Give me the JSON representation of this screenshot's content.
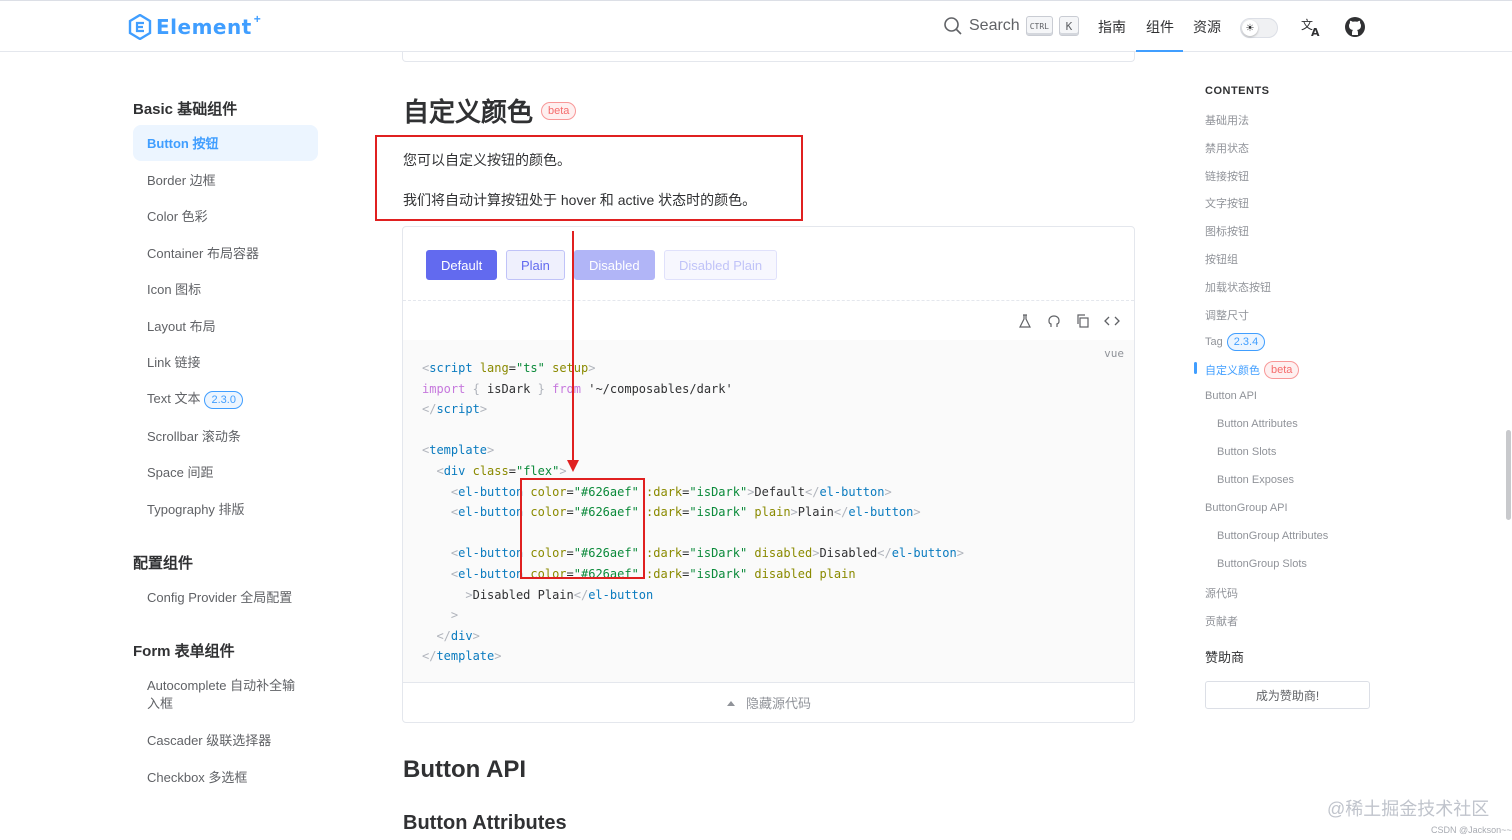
{
  "header": {
    "logo_text": "Element",
    "logo_sup": "+",
    "search_label": "Search",
    "shortcut_ctrl": "CTRL",
    "shortcut_k": "K",
    "nav": [
      "指南",
      "组件",
      "资源"
    ],
    "active_nav": "组件"
  },
  "sidebar": {
    "groups": [
      {
        "title": "Basic 基础组件",
        "items": [
          {
            "label": "Button 按钮",
            "active": true
          },
          {
            "label": "Border 边框"
          },
          {
            "label": "Color 色彩"
          },
          {
            "label": "Container 布局容器"
          },
          {
            "label": "Icon 图标"
          },
          {
            "label": "Layout 布局"
          },
          {
            "label": "Link 链接"
          },
          {
            "label": "Text 文本",
            "badge": "2.3.0"
          },
          {
            "label": "Scrollbar 滚动条"
          },
          {
            "label": "Space 间距"
          },
          {
            "label": "Typography 排版"
          }
        ]
      },
      {
        "title": "配置组件",
        "items": [
          {
            "label": "Config Provider 全局配置"
          }
        ]
      },
      {
        "title": "Form 表单组件",
        "items": [
          {
            "label": "Autocomplete 自动补全输入框"
          },
          {
            "label": "Cascader 级联选择器"
          },
          {
            "label": "Checkbox 多选框"
          }
        ]
      }
    ]
  },
  "main": {
    "section_title": "自定义颜色",
    "section_badge": "beta",
    "desc_1": "您可以自定义按钮的颜色。",
    "desc_2": "我们将自动计算按钮处于 hover 和 active 状态时的颜色。",
    "demo_buttons": {
      "default": "Default",
      "plain": "Plain",
      "disabled": "Disabled",
      "disabled_plain": "Disabled Plain"
    },
    "code_lang": "vue",
    "hide_source": "隐藏源代码",
    "api_title": "Button API",
    "attributes_title": "Button Attributes"
  },
  "toc": {
    "title": "CONTENTS",
    "items": [
      {
        "label": "基础用法",
        "level": 1
      },
      {
        "label": "禁用状态",
        "level": 1
      },
      {
        "label": "链接按钮",
        "level": 1
      },
      {
        "label": "文字按钮",
        "level": 1
      },
      {
        "label": "图标按钮",
        "level": 1
      },
      {
        "label": "按钮组",
        "level": 1
      },
      {
        "label": "加载状态按钮",
        "level": 1
      },
      {
        "label": "调整尺寸",
        "level": 1
      },
      {
        "label": "Tag",
        "level": 1,
        "badge": "2.3.4"
      },
      {
        "label": "自定义颜色",
        "level": 1,
        "badge": "beta",
        "active": true
      },
      {
        "label": "Button API",
        "level": 1
      },
      {
        "label": "Button Attributes",
        "level": 2
      },
      {
        "label": "Button Slots",
        "level": 2
      },
      {
        "label": "Button Exposes",
        "level": 2
      },
      {
        "label": "ButtonGroup API",
        "level": 1
      },
      {
        "label": "ButtonGroup Attributes",
        "level": 2
      },
      {
        "label": "ButtonGroup Slots",
        "level": 2
      },
      {
        "label": "源代码",
        "level": 1
      },
      {
        "label": "贡献者",
        "level": 1
      }
    ],
    "sponsor_title": "赞助商",
    "sponsor_button": "成为赞助商!"
  },
  "watermark": "@稀土掘金技术社区",
  "watermark_small": "CSDN @Jackson~~",
  "colors": {
    "brand": "#409eff",
    "custom": "#626aef",
    "annotation": "#e02020"
  }
}
